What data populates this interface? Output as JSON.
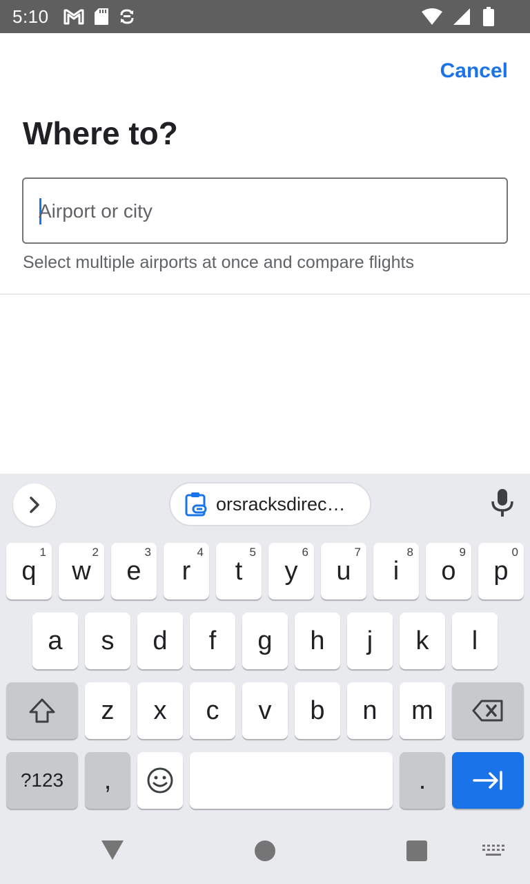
{
  "status_bar": {
    "time": "5:10",
    "icons": [
      "gmail-icon",
      "sd-card-icon",
      "sync-icon",
      "wifi-icon",
      "signal-icon",
      "battery-icon"
    ]
  },
  "header": {
    "cancel_label": "Cancel",
    "title": "Where to?"
  },
  "search": {
    "placeholder": "Airport or city",
    "value": "",
    "helper_text": "Select multiple airports at once and compare flights"
  },
  "keyboard": {
    "clipboard_chip": "orsracksdirec…",
    "row1": [
      {
        "key": "q",
        "hint": "1"
      },
      {
        "key": "w",
        "hint": "2"
      },
      {
        "key": "e",
        "hint": "3"
      },
      {
        "key": "r",
        "hint": "4"
      },
      {
        "key": "t",
        "hint": "5"
      },
      {
        "key": "y",
        "hint": "6"
      },
      {
        "key": "u",
        "hint": "7"
      },
      {
        "key": "i",
        "hint": "8"
      },
      {
        "key": "o",
        "hint": "9"
      },
      {
        "key": "p",
        "hint": "0"
      }
    ],
    "row2": [
      "a",
      "s",
      "d",
      "f",
      "g",
      "h",
      "j",
      "k",
      "l"
    ],
    "row3": [
      "z",
      "x",
      "c",
      "v",
      "b",
      "n",
      "m"
    ],
    "symbols_label": "?123",
    "comma": ",",
    "period": ".",
    "accent_color": "#1a73e8"
  },
  "nav_bar": {
    "icons": [
      "back-icon",
      "home-icon",
      "recents-icon",
      "keyboard-switch-icon"
    ]
  }
}
